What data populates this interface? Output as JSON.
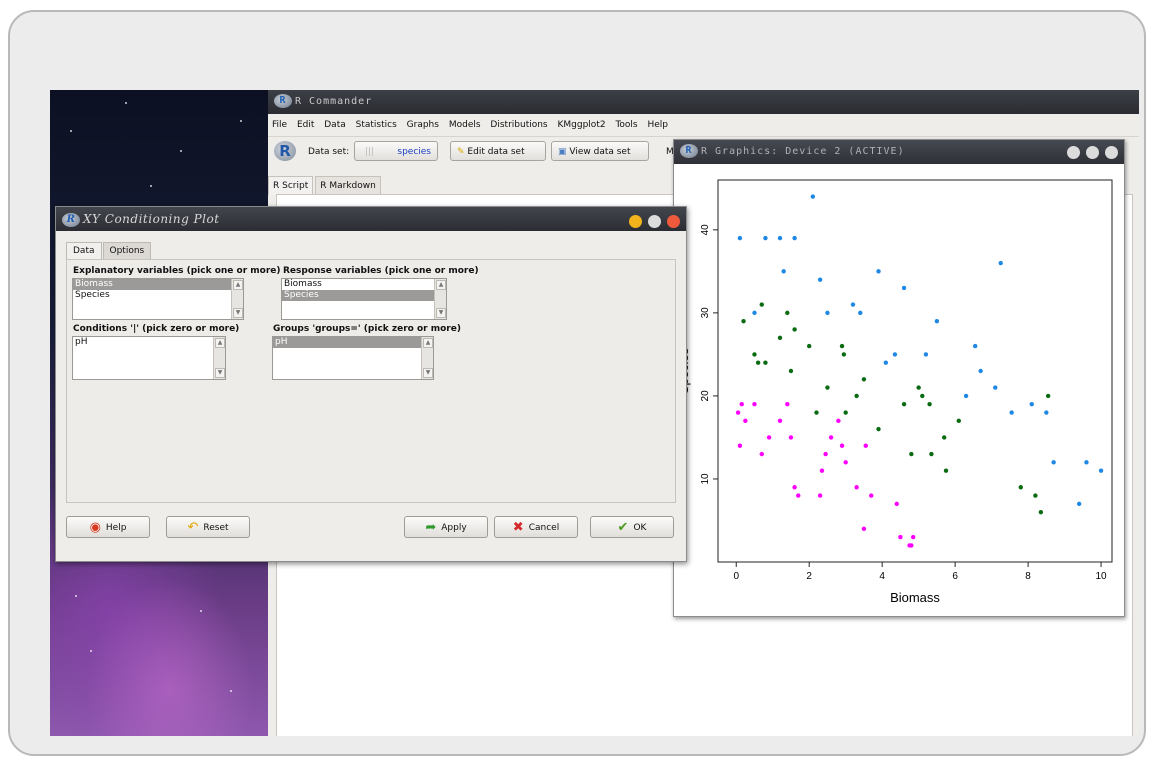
{
  "rcommander": {
    "title": "R Commander",
    "menu": [
      "File",
      "Edit",
      "Data",
      "Statistics",
      "Graphs",
      "Models",
      "Distributions",
      "KMggplot2",
      "Tools",
      "Help"
    ],
    "dataset_label": "Data set:",
    "dataset_value": "species",
    "edit_button": "Edit data set",
    "view_button": "View data set",
    "model_label_partial": "Mo",
    "tabs": [
      "R Script",
      "R Markdown"
    ]
  },
  "graphics": {
    "title": "R Graphics: Device 2 (ACTIVE)"
  },
  "dialog": {
    "title": "XY Conditioning Plot",
    "tabs": [
      "Data",
      "Options"
    ],
    "explanatory_label": "Explanatory variables (pick one or more)",
    "explanatory_items": [
      "Biomass",
      "Species"
    ],
    "response_label": "Response variables (pick one or more)",
    "response_items": [
      "Biomass",
      "Species"
    ],
    "conditions_label": "Conditions '|' (pick zero or more)",
    "conditions_items": [
      "pH"
    ],
    "groups_label": "Groups 'groups=' (pick zero or more)",
    "groups_items": [
      "pH"
    ],
    "buttons": {
      "help": "Help",
      "reset": "Reset",
      "apply": "Apply",
      "cancel": "Cancel",
      "ok": "OK"
    }
  },
  "colors": {
    "high": "#1e88e5",
    "mid": "#0a6b12",
    "low": "#ff00ff"
  },
  "chart_data": {
    "type": "scatter",
    "xlabel": "Biomass",
    "ylabel": "Species",
    "xlim": [
      -0.5,
      10.3
    ],
    "ylim": [
      0,
      46
    ],
    "xticks": [
      0,
      2,
      4,
      6,
      8,
      10
    ],
    "yticks": [
      10,
      20,
      30,
      40
    ],
    "series": [
      {
        "color": "#1e88e5",
        "points": [
          [
            0.1,
            39
          ],
          [
            0.5,
            30
          ],
          [
            0.8,
            39
          ],
          [
            1.2,
            39
          ],
          [
            1.3,
            35
          ],
          [
            1.6,
            39
          ],
          [
            2.1,
            44
          ],
          [
            2.3,
            34
          ],
          [
            2.5,
            30
          ],
          [
            3.2,
            31
          ],
          [
            3.4,
            30
          ],
          [
            3.9,
            35
          ],
          [
            4.1,
            24
          ],
          [
            4.35,
            25
          ],
          [
            4.6,
            33
          ],
          [
            5.2,
            25
          ],
          [
            5.5,
            29
          ],
          [
            6.3,
            20
          ],
          [
            6.55,
            26
          ],
          [
            6.7,
            23
          ],
          [
            7.1,
            21
          ],
          [
            7.25,
            36
          ],
          [
            7.55,
            18
          ],
          [
            8.1,
            19
          ],
          [
            8.5,
            18
          ],
          [
            8.7,
            12
          ],
          [
            9.4,
            7
          ],
          [
            9.6,
            12
          ],
          [
            10.0,
            11
          ]
        ]
      },
      {
        "color": "#0a6b12",
        "points": [
          [
            0.2,
            29
          ],
          [
            0.5,
            25
          ],
          [
            0.6,
            24
          ],
          [
            0.7,
            31
          ],
          [
            0.8,
            24
          ],
          [
            1.2,
            27
          ],
          [
            1.4,
            30
          ],
          [
            1.5,
            23
          ],
          [
            1.6,
            28
          ],
          [
            2.0,
            26
          ],
          [
            2.2,
            18
          ],
          [
            2.5,
            21
          ],
          [
            2.9,
            26
          ],
          [
            2.95,
            25
          ],
          [
            3.0,
            18
          ],
          [
            3.3,
            20
          ],
          [
            3.5,
            22
          ],
          [
            3.9,
            16
          ],
          [
            4.6,
            19
          ],
          [
            4.8,
            13
          ],
          [
            5.0,
            21
          ],
          [
            5.1,
            20
          ],
          [
            5.3,
            19
          ],
          [
            5.35,
            13
          ],
          [
            5.7,
            15
          ],
          [
            5.75,
            11
          ],
          [
            6.1,
            17
          ],
          [
            7.8,
            9
          ],
          [
            8.2,
            8
          ],
          [
            8.35,
            6
          ],
          [
            8.55,
            20
          ]
        ]
      },
      {
        "color": "#ff00ff",
        "points": [
          [
            0.05,
            18
          ],
          [
            0.1,
            14
          ],
          [
            0.15,
            19
          ],
          [
            0.25,
            17
          ],
          [
            0.5,
            19
          ],
          [
            0.7,
            13
          ],
          [
            0.9,
            15
          ],
          [
            1.2,
            17
          ],
          [
            1.4,
            19
          ],
          [
            1.5,
            15
          ],
          [
            1.6,
            9
          ],
          [
            1.7,
            8
          ],
          [
            2.3,
            8
          ],
          [
            2.35,
            11
          ],
          [
            2.45,
            13
          ],
          [
            2.6,
            15
          ],
          [
            2.8,
            17
          ],
          [
            2.9,
            14
          ],
          [
            3.0,
            12
          ],
          [
            3.3,
            9
          ],
          [
            3.5,
            4
          ],
          [
            3.55,
            14
          ],
          [
            3.7,
            8
          ],
          [
            4.4,
            7
          ],
          [
            4.5,
            3
          ],
          [
            4.75,
            2
          ],
          [
            4.85,
            3
          ],
          [
            4.8,
            2
          ]
        ]
      }
    ]
  }
}
